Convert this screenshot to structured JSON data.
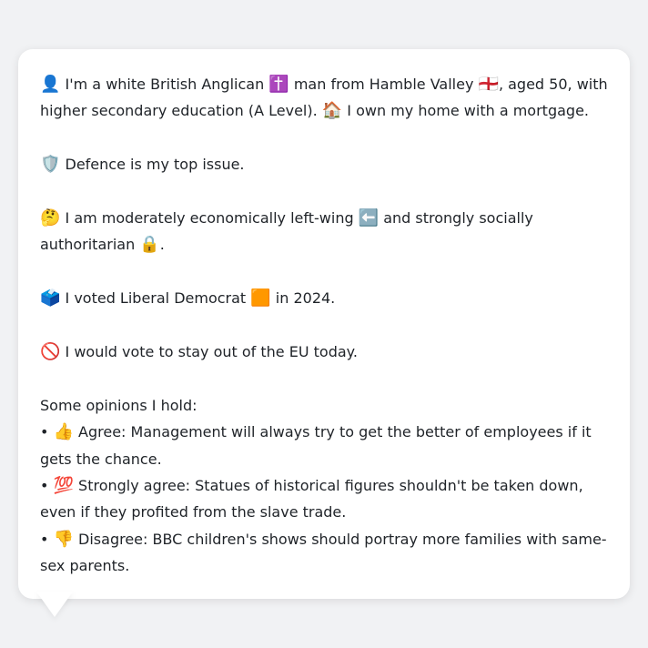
{
  "intro": {
    "e1": "👤",
    "t1": " I'm a white British Anglican ",
    "e2": "✝️",
    "t2": " man from Hamble Valley ",
    "e3": "🏴󠁧󠁢󠁥󠁮󠁧󠁿",
    "t3": ", aged 50, with higher secondary education (A Level). ",
    "e4": "🏠",
    "t4": " I own my home with a mortgage."
  },
  "issue": {
    "e1": "🛡️",
    "t1": " Defence is my top issue."
  },
  "ideology": {
    "e1": "🤔",
    "t1": " I am moderately economically left-wing ",
    "e2": "⬅️",
    "t2": " and strongly socially authoritarian ",
    "e3": "🔒",
    "t3": "."
  },
  "vote": {
    "e1": "🗳️",
    "t1": " I voted Liberal Democrat ",
    "e2": "🟧",
    "t2": " in 2024."
  },
  "eu": {
    "e1": "🚫",
    "t1": " I would vote to stay out of the EU today."
  },
  "opinions": {
    "heading": "Some opinions I hold:",
    "items": [
      {
        "bullet": "• ",
        "emoji": "👍",
        "text": " Agree: Management will always try to get the better of employees if it gets the chance."
      },
      {
        "bullet": "• ",
        "emoji": "💯",
        "text": " Strongly agree: Statues of historical figures shouldn't be taken down, even if they profited from the slave trade."
      },
      {
        "bullet": "• ",
        "emoji": "👎",
        "text": " Disagree: BBC children's shows should portray more families with same-sex parents."
      }
    ]
  }
}
